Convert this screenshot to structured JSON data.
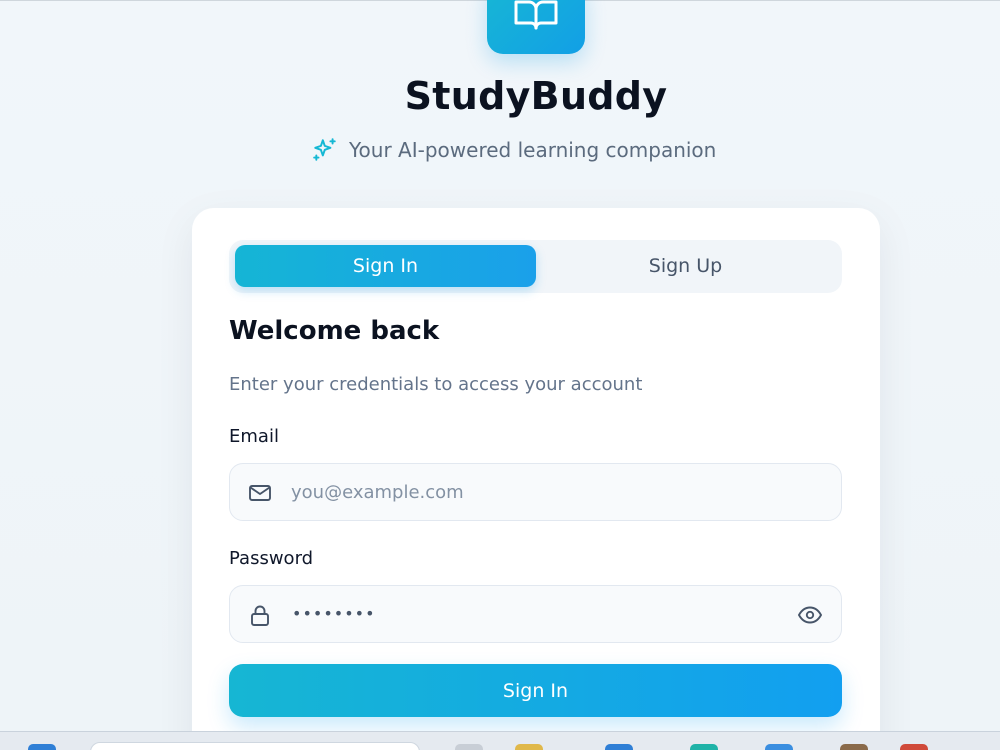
{
  "app": {
    "title": "StudyBuddy",
    "tagline": "Your AI-powered learning companion"
  },
  "tabs": [
    {
      "label": "Sign In",
      "active": true
    },
    {
      "label": "Sign Up",
      "active": false
    }
  ],
  "form": {
    "heading": "Welcome back",
    "description": "Enter your credentials to access your account",
    "email_label": "Email",
    "email_placeholder": "you@example.com",
    "password_label": "Password",
    "password_masked": "••••••••",
    "submit_label": "Sign In"
  },
  "icons": {
    "logo": "book-open-icon",
    "tagline": "sparkles-icon",
    "email": "mail-icon",
    "password": "lock-icon",
    "toggle": "eye-icon"
  },
  "colors": {
    "accent_start": "#15b5d5",
    "accent_end": "#1aa0ea",
    "heading": "#0b1220",
    "muted": "#64748b"
  }
}
